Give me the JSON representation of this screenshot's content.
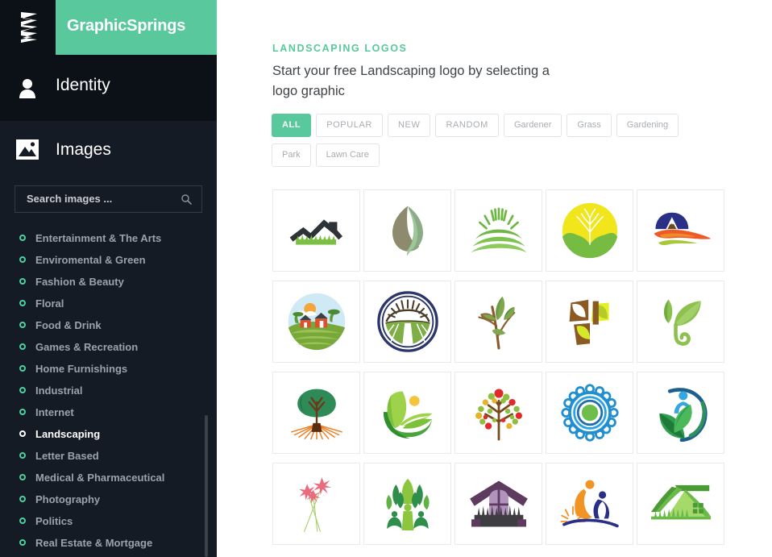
{
  "brand": {
    "logo_icon": "spring-zigzag-icon",
    "title": "GraphicSprings",
    "accent_color": "#59c89c",
    "sidebar_color": "#151b24"
  },
  "sidebar": {
    "identity": {
      "icon": "person-icon",
      "label": "Identity"
    },
    "images": {
      "icon": "image-icon",
      "label": "Images"
    },
    "search": {
      "icon": "search-icon",
      "placeholder": "Search images ...",
      "value": ""
    },
    "categories": [
      {
        "label": "Entertainment & The Arts",
        "active": false
      },
      {
        "label": "Enviromental & Green",
        "active": false
      },
      {
        "label": "Fashion & Beauty",
        "active": false
      },
      {
        "label": "Floral",
        "active": false
      },
      {
        "label": "Food & Drink",
        "active": false
      },
      {
        "label": "Games & Recreation",
        "active": false
      },
      {
        "label": "Home Furnishings",
        "active": false
      },
      {
        "label": "Industrial",
        "active": false
      },
      {
        "label": "Internet",
        "active": false
      },
      {
        "label": "Landscaping",
        "active": true
      },
      {
        "label": "Letter Based",
        "active": false
      },
      {
        "label": "Medical & Pharmaceutical",
        "active": false
      },
      {
        "label": "Photography",
        "active": false
      },
      {
        "label": "Politics",
        "active": false
      },
      {
        "label": "Real Estate & Mortgage",
        "active": false
      }
    ]
  },
  "main": {
    "eyebrow": "LANDSCAPING LOGOS",
    "headline": "Start your free Landscaping logo by selecting a logo graphic",
    "filters": [
      {
        "label": "ALL",
        "active": true,
        "upper": true
      },
      {
        "label": "POPULAR",
        "active": false,
        "upper": true
      },
      {
        "label": "NEW",
        "active": false,
        "upper": true
      },
      {
        "label": "RANDOM",
        "active": false,
        "upper": true
      },
      {
        "label": "Gardener",
        "active": false,
        "upper": false
      },
      {
        "label": "Grass",
        "active": false,
        "upper": false
      },
      {
        "label": "Gardening",
        "active": false,
        "upper": false
      },
      {
        "label": "Park",
        "active": false,
        "upper": false
      },
      {
        "label": "Lawn Care",
        "active": false,
        "upper": false
      }
    ],
    "logo_tiles": [
      {
        "name": "mountain-grass-logo",
        "row": 1,
        "col": 1
      },
      {
        "name": "two-tone-leaf-logo",
        "row": 1,
        "col": 2
      },
      {
        "name": "sunrise-over-hills-logo",
        "row": 1,
        "col": 3
      },
      {
        "name": "tree-in-yellow-circle-logo",
        "row": 1,
        "col": 4
      },
      {
        "name": "blue-mountain-river-logo",
        "row": 1,
        "col": 5
      },
      {
        "name": "farm-scene-circle-logo",
        "row": 2,
        "col": 1
      },
      {
        "name": "sun-field-roundel-logo",
        "row": 2,
        "col": 2
      },
      {
        "name": "seedling-sprout-logo",
        "row": 2,
        "col": 3
      },
      {
        "name": "brown-yellow-cross-leaf-logo",
        "row": 2,
        "col": 4
      },
      {
        "name": "leaf-swirl-logo",
        "row": 2,
        "col": 5
      },
      {
        "name": "tree-with-rays-logo",
        "row": 3,
        "col": 1
      },
      {
        "name": "leaf-field-sun-logo",
        "row": 3,
        "col": 2
      },
      {
        "name": "fruit-tree-dots-logo",
        "row": 3,
        "col": 3
      },
      {
        "name": "blue-flower-mandala-logo",
        "row": 3,
        "col": 4
      },
      {
        "name": "person-leaf-circle-logo",
        "row": 3,
        "col": 5
      },
      {
        "name": "pink-flowers-logo",
        "row": 4,
        "col": 1
      },
      {
        "name": "people-tree-logo",
        "row": 4,
        "col": 2
      },
      {
        "name": "house-gable-grass-logo",
        "row": 4,
        "col": 3
      },
      {
        "name": "two-people-sunrise-logo",
        "row": 4,
        "col": 4
      },
      {
        "name": "green-house-roof-logo",
        "row": 4,
        "col": 5
      }
    ]
  }
}
